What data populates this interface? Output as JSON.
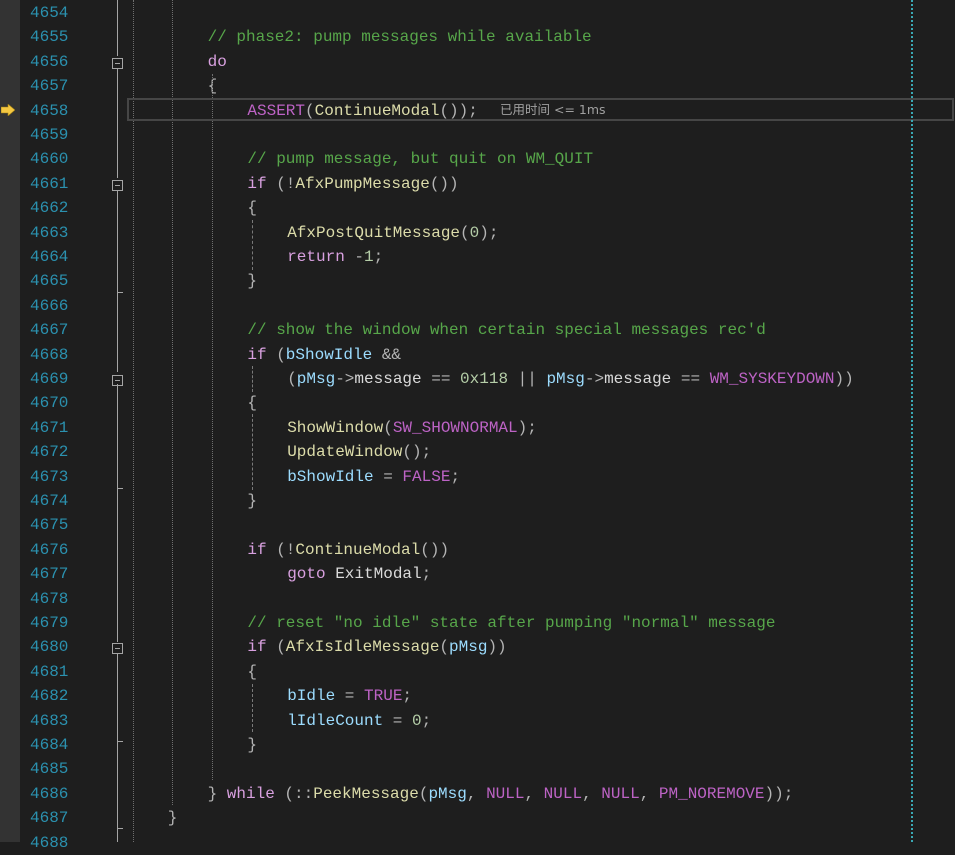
{
  "editor": {
    "colors": {
      "comment": "#57a64a",
      "keyword": "#d8a0df",
      "function": "#dcdcaa",
      "variable": "#9cdcfe",
      "macro": "#bd63c5",
      "number": "#b5cea8",
      "line_number": "#2b91af",
      "background": "#1e1e1e"
    },
    "current_line": 4658,
    "current_line_hint": "已用时间 <= 1ms",
    "arrow_icon": "instruction-pointer-arrow-icon",
    "fold_icon": "collapse-minus-icon",
    "lines": [
      {
        "n": "4654",
        "indent": 0,
        "tokens": []
      },
      {
        "n": "4655",
        "indent": 2,
        "tokens": [
          {
            "t": "// phase2: pump messages while available",
            "c": "com"
          }
        ]
      },
      {
        "n": "4656",
        "indent": 2,
        "fold": true,
        "tokens": [
          {
            "t": "do",
            "c": "kw"
          }
        ]
      },
      {
        "n": "4657",
        "indent": 2,
        "tokens": [
          {
            "t": "{",
            "c": "pun"
          }
        ]
      },
      {
        "n": "4658",
        "indent": 3,
        "tokens": [
          {
            "t": "ASSERT",
            "c": "mac"
          },
          {
            "t": "(",
            "c": "pun"
          },
          {
            "t": "ContinueModal",
            "c": "fn"
          },
          {
            "t": "());",
            "c": "pun"
          }
        ]
      },
      {
        "n": "4659",
        "indent": 0,
        "tokens": []
      },
      {
        "n": "4660",
        "indent": 3,
        "tokens": [
          {
            "t": "// pump message, but quit on WM_QUIT",
            "c": "com"
          }
        ]
      },
      {
        "n": "4661",
        "indent": 3,
        "fold": true,
        "tokens": [
          {
            "t": "if",
            "c": "kw"
          },
          {
            "t": " (!",
            "c": "pun"
          },
          {
            "t": "AfxPumpMessage",
            "c": "fn"
          },
          {
            "t": "())",
            "c": "pun"
          }
        ]
      },
      {
        "n": "4662",
        "indent": 3,
        "tokens": [
          {
            "t": "{",
            "c": "pun"
          }
        ]
      },
      {
        "n": "4663",
        "indent": 4,
        "tokens": [
          {
            "t": "AfxPostQuitMessage",
            "c": "fn"
          },
          {
            "t": "(",
            "c": "pun"
          },
          {
            "t": "0",
            "c": "num"
          },
          {
            "t": ");",
            "c": "pun"
          }
        ]
      },
      {
        "n": "4664",
        "indent": 4,
        "tokens": [
          {
            "t": "return",
            "c": "kw"
          },
          {
            "t": " -",
            "c": "pun"
          },
          {
            "t": "1",
            "c": "num"
          },
          {
            "t": ";",
            "c": "pun"
          }
        ]
      },
      {
        "n": "4665",
        "indent": 3,
        "tokens": [
          {
            "t": "}",
            "c": "pun"
          }
        ]
      },
      {
        "n": "4666",
        "indent": 0,
        "tokens": []
      },
      {
        "n": "4667",
        "indent": 3,
        "tokens": [
          {
            "t": "// show the window when certain special messages rec'd",
            "c": "com"
          }
        ]
      },
      {
        "n": "4668",
        "indent": 3,
        "tokens": [
          {
            "t": "if",
            "c": "kw"
          },
          {
            "t": " (",
            "c": "pun"
          },
          {
            "t": "bShowIdle",
            "c": "var"
          },
          {
            "t": " &&",
            "c": "pun"
          }
        ]
      },
      {
        "n": "4669",
        "indent": 4,
        "fold": true,
        "tokens": [
          {
            "t": "(",
            "c": "pun"
          },
          {
            "t": "pMsg",
            "c": "var"
          },
          {
            "t": "->",
            "c": "pun"
          },
          {
            "t": "message",
            "c": "def"
          },
          {
            "t": " == ",
            "c": "pun"
          },
          {
            "t": "0x118",
            "c": "num"
          },
          {
            "t": " || ",
            "c": "pun"
          },
          {
            "t": "pMsg",
            "c": "var"
          },
          {
            "t": "->",
            "c": "pun"
          },
          {
            "t": "message",
            "c": "def"
          },
          {
            "t": " == ",
            "c": "pun"
          },
          {
            "t": "WM_SYSKEYDOWN",
            "c": "mac"
          },
          {
            "t": "))",
            "c": "pun"
          }
        ]
      },
      {
        "n": "4670",
        "indent": 3,
        "tokens": [
          {
            "t": "{",
            "c": "pun"
          }
        ]
      },
      {
        "n": "4671",
        "indent": 4,
        "tokens": [
          {
            "t": "ShowWindow",
            "c": "fn"
          },
          {
            "t": "(",
            "c": "pun"
          },
          {
            "t": "SW_SHOWNORMAL",
            "c": "mac"
          },
          {
            "t": ");",
            "c": "pun"
          }
        ]
      },
      {
        "n": "4672",
        "indent": 4,
        "tokens": [
          {
            "t": "UpdateWindow",
            "c": "fn"
          },
          {
            "t": "();",
            "c": "pun"
          }
        ]
      },
      {
        "n": "4673",
        "indent": 4,
        "tokens": [
          {
            "t": "bShowIdle",
            "c": "var"
          },
          {
            "t": " = ",
            "c": "pun"
          },
          {
            "t": "FALSE",
            "c": "mac"
          },
          {
            "t": ";",
            "c": "pun"
          }
        ]
      },
      {
        "n": "4674",
        "indent": 3,
        "tokens": [
          {
            "t": "}",
            "c": "pun"
          }
        ]
      },
      {
        "n": "4675",
        "indent": 0,
        "tokens": []
      },
      {
        "n": "4676",
        "indent": 3,
        "tokens": [
          {
            "t": "if",
            "c": "kw"
          },
          {
            "t": " (!",
            "c": "pun"
          },
          {
            "t": "ContinueModal",
            "c": "fn"
          },
          {
            "t": "())",
            "c": "pun"
          }
        ]
      },
      {
        "n": "4677",
        "indent": 4,
        "tokens": [
          {
            "t": "goto",
            "c": "kw"
          },
          {
            "t": " ",
            "c": "pun"
          },
          {
            "t": "ExitModal",
            "c": "def"
          },
          {
            "t": ";",
            "c": "pun"
          }
        ]
      },
      {
        "n": "4678",
        "indent": 0,
        "tokens": []
      },
      {
        "n": "4679",
        "indent": 3,
        "tokens": [
          {
            "t": "// reset \"no idle\" state after pumping \"normal\" message",
            "c": "com"
          }
        ]
      },
      {
        "n": "4680",
        "indent": 3,
        "fold": true,
        "tokens": [
          {
            "t": "if",
            "c": "kw"
          },
          {
            "t": " (",
            "c": "pun"
          },
          {
            "t": "AfxIsIdleMessage",
            "c": "fn"
          },
          {
            "t": "(",
            "c": "pun"
          },
          {
            "t": "pMsg",
            "c": "var"
          },
          {
            "t": "))",
            "c": "pun"
          }
        ]
      },
      {
        "n": "4681",
        "indent": 3,
        "tokens": [
          {
            "t": "{",
            "c": "pun"
          }
        ]
      },
      {
        "n": "4682",
        "indent": 4,
        "tokens": [
          {
            "t": "bIdle",
            "c": "var"
          },
          {
            "t": " = ",
            "c": "pun"
          },
          {
            "t": "TRUE",
            "c": "mac"
          },
          {
            "t": ";",
            "c": "pun"
          }
        ]
      },
      {
        "n": "4683",
        "indent": 4,
        "tokens": [
          {
            "t": "lIdleCount",
            "c": "var"
          },
          {
            "t": " = ",
            "c": "pun"
          },
          {
            "t": "0",
            "c": "num"
          },
          {
            "t": ";",
            "c": "pun"
          }
        ]
      },
      {
        "n": "4684",
        "indent": 3,
        "tokens": [
          {
            "t": "}",
            "c": "pun"
          }
        ]
      },
      {
        "n": "4685",
        "indent": 0,
        "tokens": []
      },
      {
        "n": "4686",
        "indent": 2,
        "tokens": [
          {
            "t": "} ",
            "c": "pun"
          },
          {
            "t": "while",
            "c": "kw"
          },
          {
            "t": " (::",
            "c": "pun"
          },
          {
            "t": "PeekMessage",
            "c": "fn"
          },
          {
            "t": "(",
            "c": "pun"
          },
          {
            "t": "pMsg",
            "c": "var"
          },
          {
            "t": ", ",
            "c": "pun"
          },
          {
            "t": "NULL",
            "c": "mac"
          },
          {
            "t": ", ",
            "c": "pun"
          },
          {
            "t": "NULL",
            "c": "mac"
          },
          {
            "t": ", ",
            "c": "pun"
          },
          {
            "t": "NULL",
            "c": "mac"
          },
          {
            "t": ", ",
            "c": "pun"
          },
          {
            "t": "PM_NOREMOVE",
            "c": "mac"
          },
          {
            "t": "));",
            "c": "pun"
          }
        ]
      },
      {
        "n": "4687",
        "indent": 1,
        "tokens": [
          {
            "t": "}",
            "c": "pun"
          }
        ]
      },
      {
        "n": "4688",
        "indent": 0,
        "tokens": []
      }
    ]
  }
}
